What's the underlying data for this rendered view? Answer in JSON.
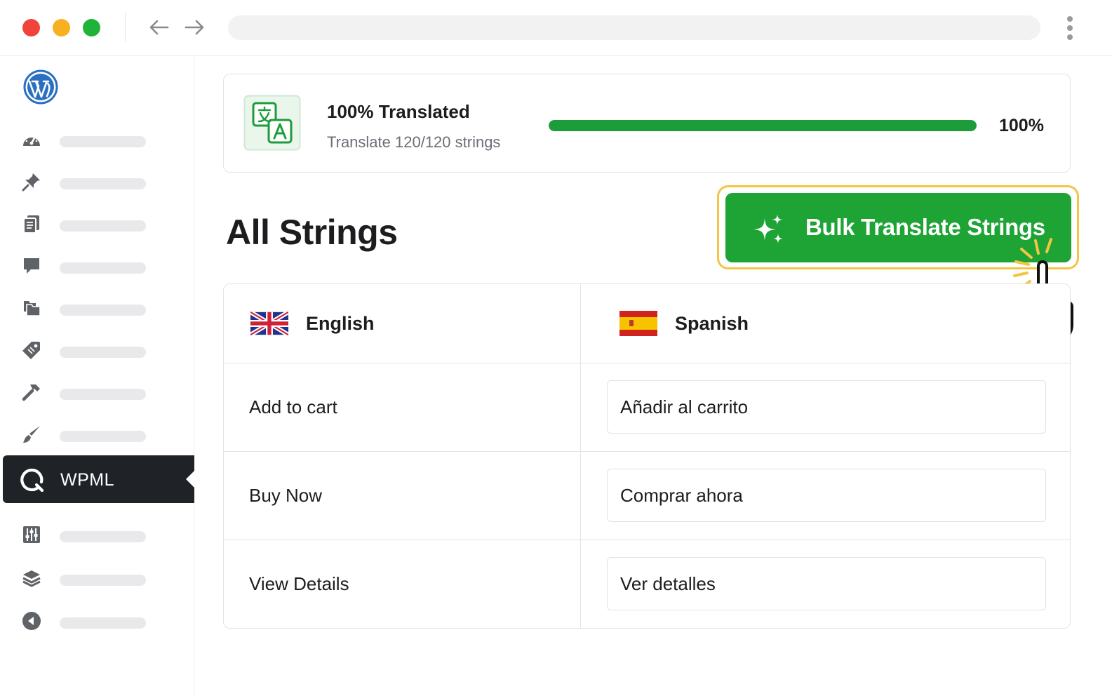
{
  "browser": {
    "icons": {
      "back": "arrow-left-icon",
      "forward": "arrow-right-icon",
      "menu": "kebab-menu-icon"
    }
  },
  "sidebar": {
    "logo_icon": "wordpress-logo-icon",
    "items": [
      {
        "icon": "dashboard-gauge-icon"
      },
      {
        "icon": "pushpin-icon"
      },
      {
        "icon": "pages-icon"
      },
      {
        "icon": "comment-icon"
      },
      {
        "icon": "folders-icon"
      },
      {
        "icon": "tag-icon"
      },
      {
        "icon": "hammer-icon"
      },
      {
        "icon": "brush-icon"
      }
    ],
    "active": {
      "label": "WPML",
      "icon": "wpml-icon"
    },
    "items_after": [
      {
        "icon": "sliders-icon"
      },
      {
        "icon": "layers-icon"
      },
      {
        "icon": "collapse-icon"
      }
    ]
  },
  "progress": {
    "title": "100% Translated",
    "subtitle": "Translate 120/120 strings",
    "percent_label": "100%",
    "fraction": 1.0,
    "bar_color": "#1c9c3a",
    "icon": "translate-icon"
  },
  "main": {
    "title": "All Strings",
    "bulk_button_label": "Bulk Translate Strings",
    "bulk_button_color": "#1ea335",
    "highlight_color": "#f4c542"
  },
  "table": {
    "source_language": {
      "name": "English",
      "flag": "uk-flag-icon"
    },
    "target_language": {
      "name": "Spanish",
      "flag": "spain-flag-icon"
    },
    "rows": [
      {
        "source": "Add to cart",
        "translation": "Añadir al carrito"
      },
      {
        "source": "Buy Now",
        "translation": "Comprar ahora"
      },
      {
        "source": "View Details",
        "translation": "Ver detalles"
      }
    ]
  }
}
